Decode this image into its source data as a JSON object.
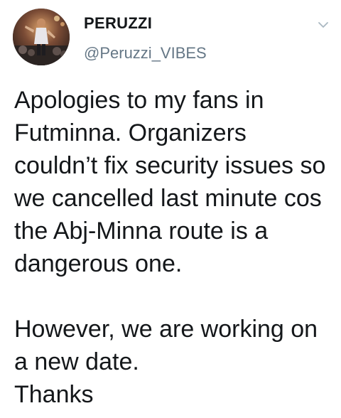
{
  "tweet": {
    "author": {
      "display_name": "PERUZZI",
      "handle": "@Peruzzi_VIBES",
      "avatar_icon": "profile-photo"
    },
    "menu_icon": "chevron-down-icon",
    "text": {
      "paragraph_1": "Apologies to my fans in Futminna. Organizers couldn’t fix security issues so we cancelled last minute cos the Abj-Minna route is a dangerous one.",
      "paragraph_2": "However, we are working on a new date.",
      "paragraph_3": "Thanks"
    }
  },
  "colors": {
    "name": "#14171a",
    "handle": "#657786",
    "chevron": "#aab8c2",
    "background": "#ffffff"
  }
}
